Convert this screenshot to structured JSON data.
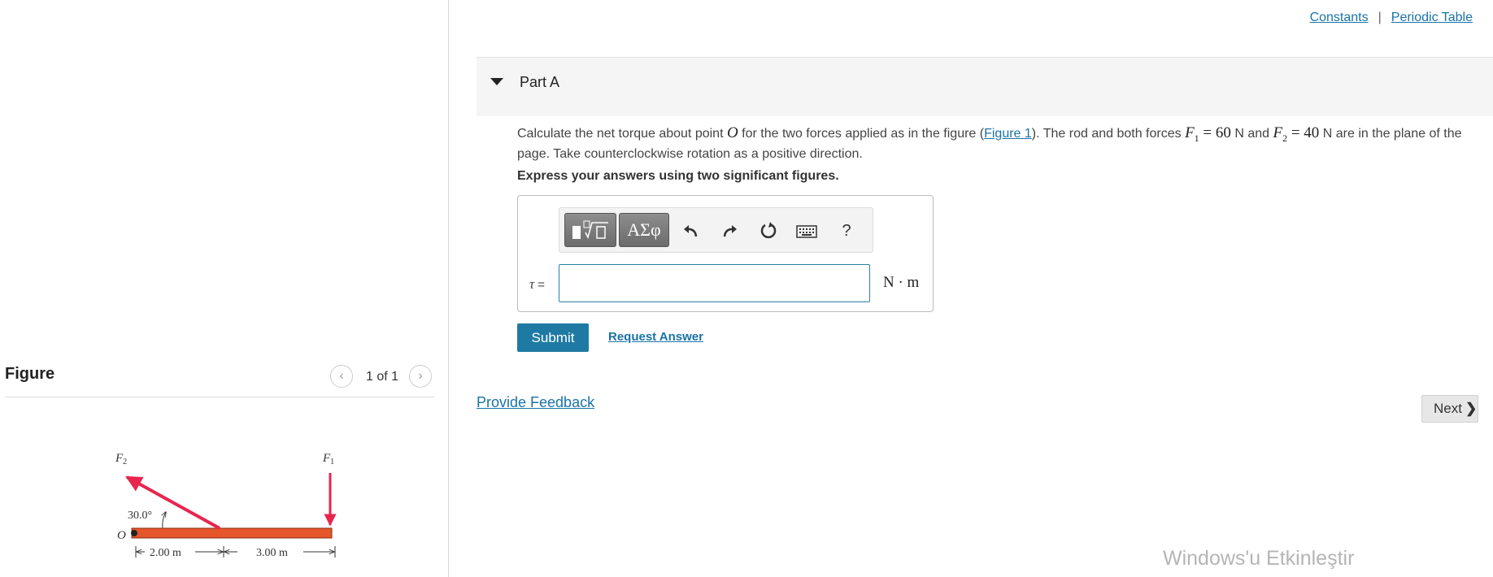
{
  "header": {
    "constants_label": "Constants",
    "separator": "|",
    "periodic_table_label": "Periodic Table"
  },
  "part": {
    "label": "Part A"
  },
  "question": {
    "text_1": "Calculate the net torque about point ",
    "point": "O",
    "text_2": " for the two forces applied as in the figure (",
    "figure_link": "Figure 1",
    "text_3": "). The rod and both forces ",
    "f1_symbol": "F",
    "f1_sub": "1",
    "f1_value": " = 60",
    "text_4": " N and ",
    "f2_symbol": "F",
    "f2_sub": "2",
    "f2_value": " = 40",
    "text_5": " N are in the plane of the page. Take counterclockwise rotation as a positive direction.",
    "instruction": "Express your answers using two significant figures."
  },
  "toolbar": {
    "templates_icon": "templates-icon",
    "greek_label": "ΑΣφ",
    "undo_icon": "undo-icon",
    "redo_icon": "redo-icon",
    "reset_icon": "reset-icon",
    "keyboard_icon": "keyboard-icon",
    "help_label": "?"
  },
  "answer": {
    "symbol": "τ",
    "equals": "=",
    "value": "",
    "unit": "N · m"
  },
  "actions": {
    "submit_label": "Submit",
    "request_answer_label": "Request Answer",
    "provide_feedback_label": "Provide Feedback",
    "next_label": "Next"
  },
  "figure_panel": {
    "title": "Figure",
    "page_count": "1 of 1",
    "diagram": {
      "f1_label": "F",
      "f1_sub": "1",
      "f2_label": "F",
      "f2_sub": "2",
      "angle_label": "30.0°",
      "origin_label": "O",
      "dim_1": "2.00 m",
      "dim_2": "3.00 m",
      "rod_color": "#e5562a",
      "force_color": "#e8254f"
    }
  },
  "watermark": {
    "text": "Windows'u Etkinleştir"
  },
  "colors": {
    "accent": "#1f7aa3",
    "link": "#1a73a8"
  }
}
